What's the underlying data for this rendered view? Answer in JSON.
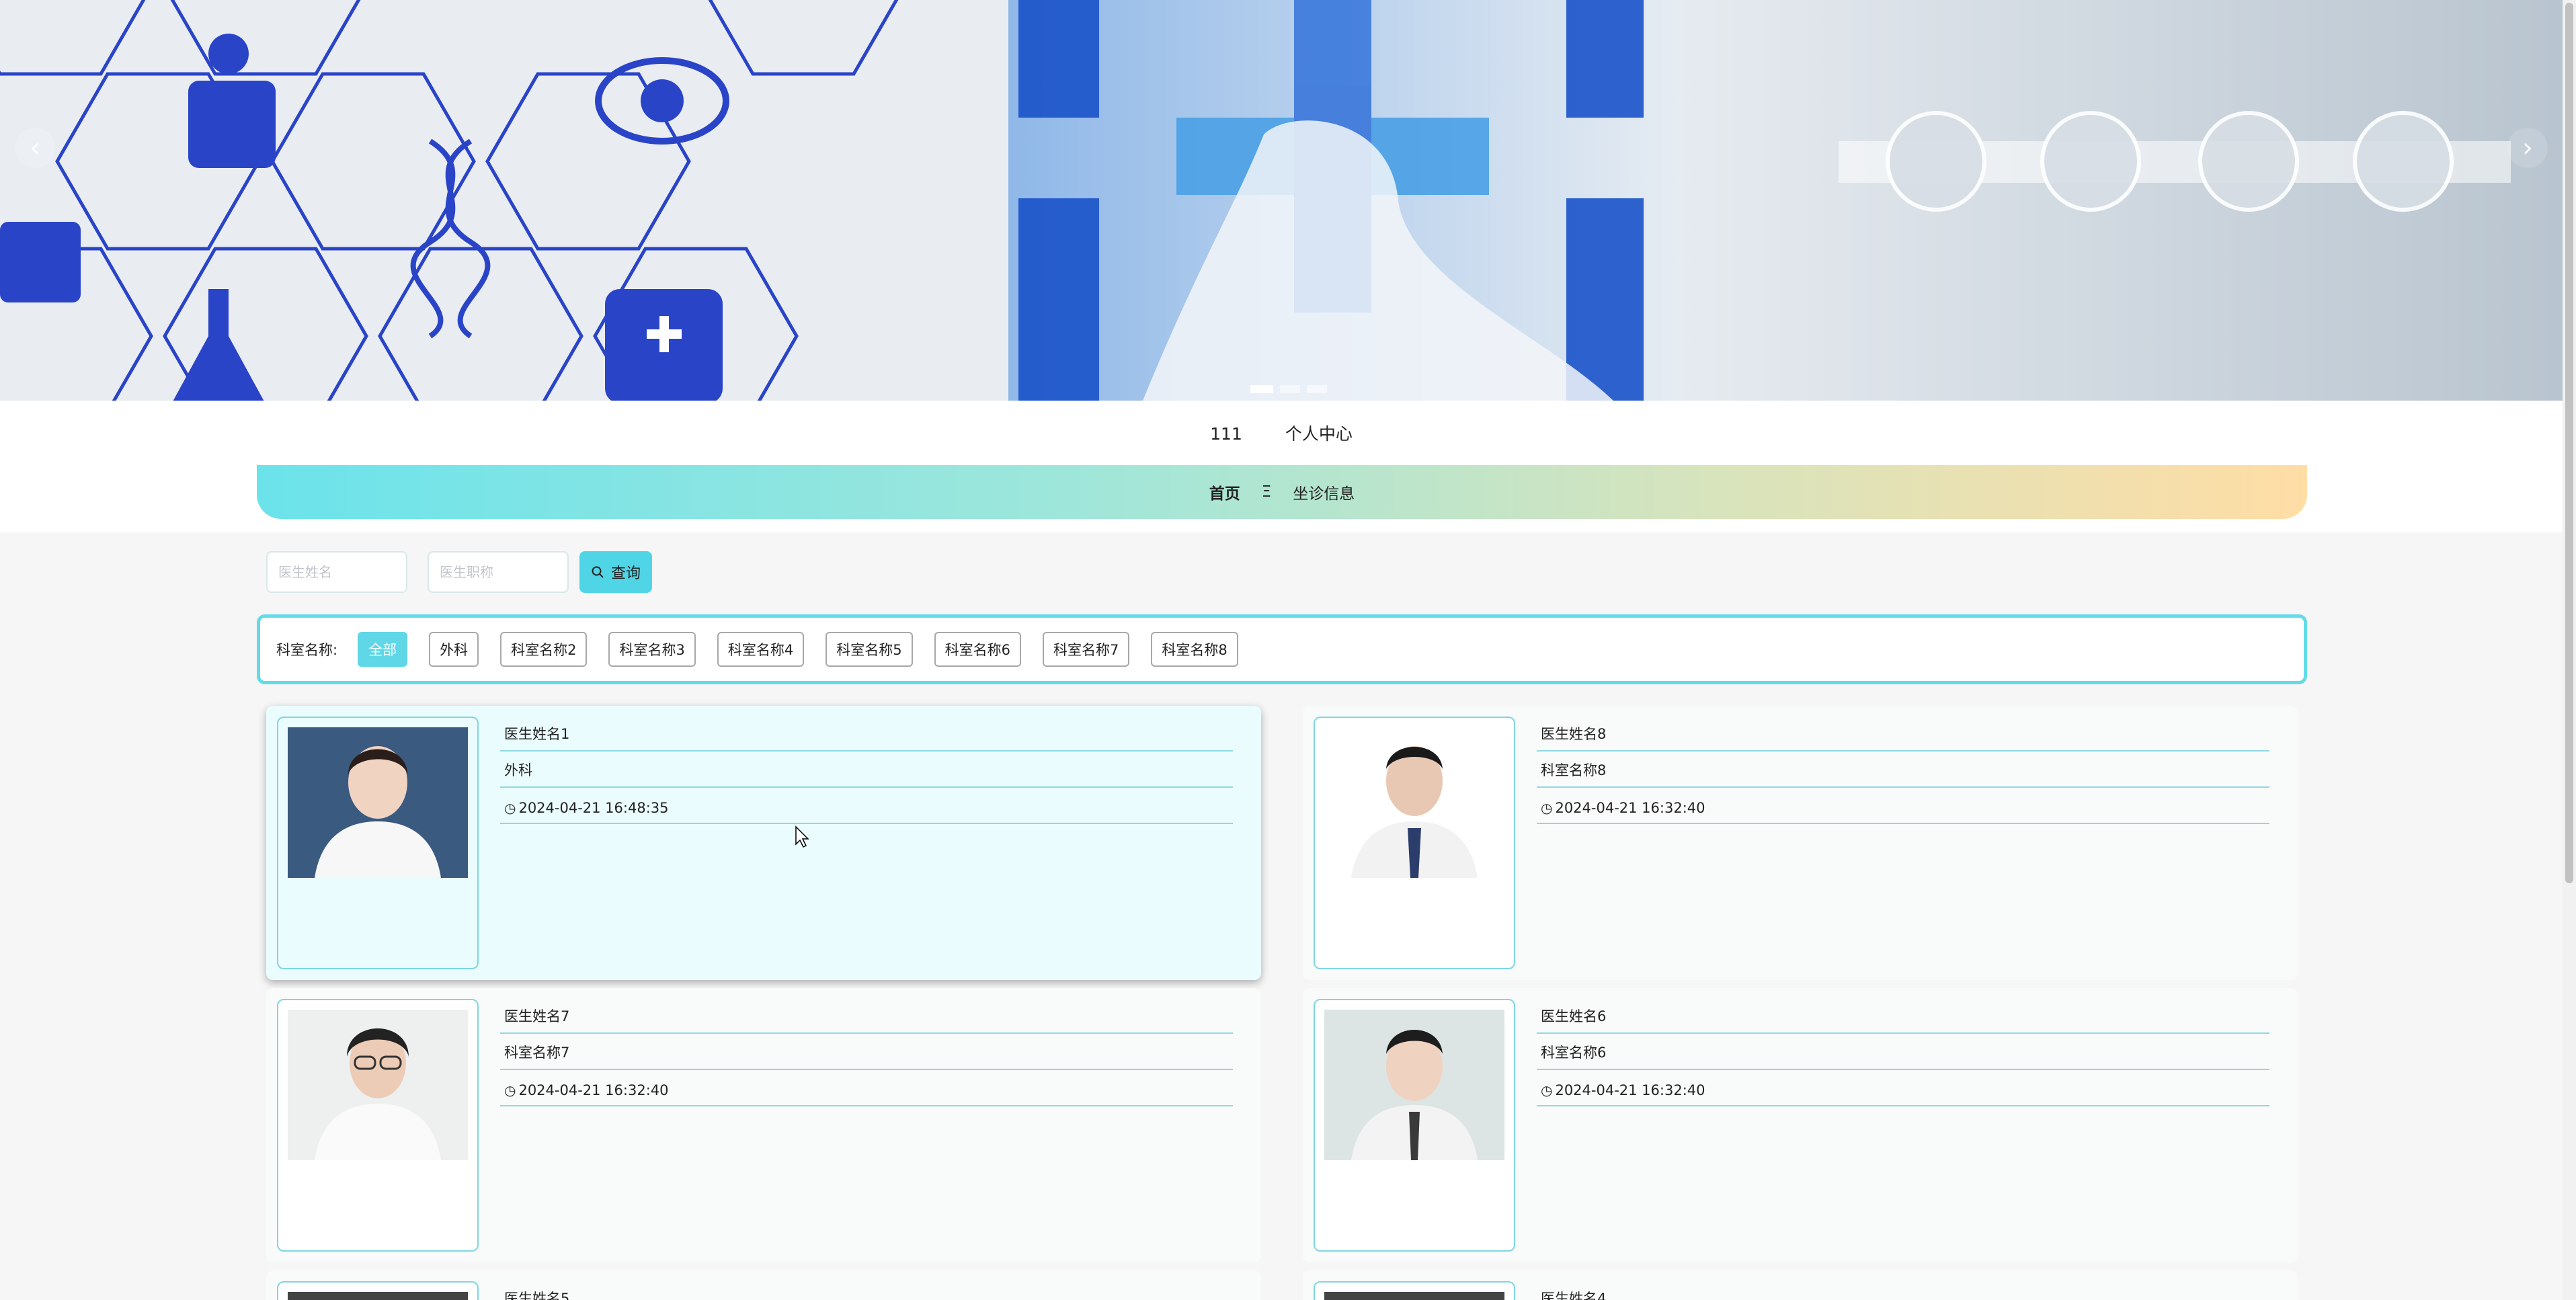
{
  "header": {
    "username": "111",
    "personal_center": "个人中心"
  },
  "nav": {
    "home": "首页",
    "separator": "Ξ",
    "page": "坐诊信息"
  },
  "search": {
    "name_placeholder": "医生姓名",
    "title_placeholder": "医生职称",
    "button_label": "查询"
  },
  "departments": {
    "label": "科室名称:",
    "items": [
      "全部",
      "外科",
      "科室名称2",
      "科室名称3",
      "科室名称4",
      "科室名称5",
      "科室名称6",
      "科室名称7",
      "科室名称8"
    ],
    "selected": "全部"
  },
  "doctors": [
    {
      "name": "医生姓名1",
      "department": "外科",
      "time": "2024-04-21 16:48:35"
    },
    {
      "name": "医生姓名8",
      "department": "科室名称8",
      "time": "2024-04-21 16:32:40"
    },
    {
      "name": "医生姓名7",
      "department": "科室名称7",
      "time": "2024-04-21 16:32:40"
    },
    {
      "name": "医生姓名6",
      "department": "科室名称6",
      "time": "2024-04-21 16:32:40"
    },
    {
      "name": "医生姓名5",
      "department": "",
      "time": ""
    },
    {
      "name": "医生姓名4",
      "department": "",
      "time": ""
    }
  ],
  "icons": {
    "search": "search-icon",
    "clock": "clock-icon",
    "prev": "chevron-left-icon",
    "next": "chevron-right-icon"
  },
  "colors": {
    "accent": "#4fd5e6",
    "card_border": "#7fd6e3",
    "nav_start": "#6be3eb",
    "nav_end": "#ffdda5"
  }
}
